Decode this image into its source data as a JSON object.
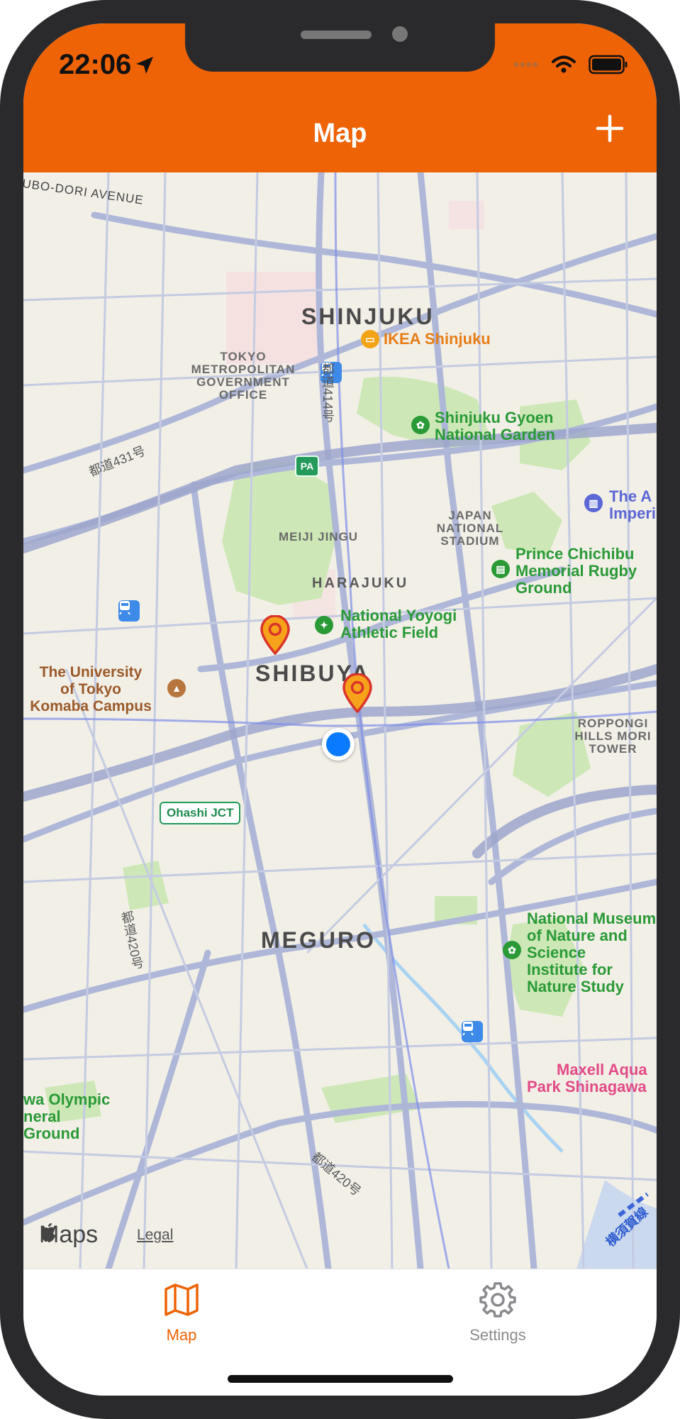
{
  "status_bar": {
    "time": "22:06"
  },
  "nav": {
    "title": "Map",
    "add_icon": "plus-icon"
  },
  "map": {
    "districts": {
      "shinjuku": "SHINJUKU",
      "shibuya": "SHIBUYA",
      "meguro": "MEGURO",
      "harajuku": "HARAJUKU"
    },
    "avenue": "UBO-DORI AVENUE",
    "labels": {
      "ikea": "IKEA Shinjuku",
      "tmgo_1": "TOKYO",
      "tmgo_2": "METROPOLITAN",
      "tmgo_3": "GOVERNMENT",
      "tmgo_4": "OFFICE",
      "gyoen_1": "Shinjuku Gyoen",
      "gyoen_2": "National Garden",
      "meiji": "MEIJI JINGU",
      "jns_1": "JAPAN",
      "jns_2": "NATIONAL",
      "jns_3": "STADIUM",
      "imperial_1": "The A",
      "imperial_2": "Imperi",
      "chichibu_1": "Prince Chichibu",
      "chichibu_2": "Memorial Rugby",
      "chichibu_3": "Ground",
      "yoyogi_1": "National Yoyogi",
      "yoyogi_2": "Athletic Field",
      "utokyo_1": "The University",
      "utokyo_2": "of Tokyo",
      "utokyo_3": "Komaba Campus",
      "roppongi_1": "ROPPONGI",
      "roppongi_2": "HILLS MORI",
      "roppongi_3": "TOWER",
      "museum_1": "National Museum",
      "museum_2": "of Nature and",
      "museum_3": "Science",
      "museum_4": "Institute for",
      "museum_5": "Nature Study",
      "maxell_1": "Maxell Aqua",
      "maxell_2": "Park Shinagawa",
      "olympic_1": "wa Olympic",
      "olympic_2": "neral",
      "olympic_3": "Ground"
    },
    "roads": {
      "r414": "都道414号",
      "r431": "都道431号",
      "r420a": "都道420号",
      "r420b": "都道420号",
      "yokosuka": "横須賀線"
    },
    "badges": {
      "ohashi": "Ohashi JCT",
      "pa": "PA"
    },
    "brand": "Maps",
    "legal": "Legal",
    "colors": {
      "park": "#cde8b6",
      "road": "#aeb7d8",
      "water": "#a9d3f2",
      "pin": "#e8402b"
    }
  },
  "tabs": [
    {
      "label": "Map",
      "icon": "map-icon",
      "active": true
    },
    {
      "label": "Settings",
      "icon": "gear-icon",
      "active": false
    }
  ],
  "theme": {
    "accent": "#ee6306"
  }
}
